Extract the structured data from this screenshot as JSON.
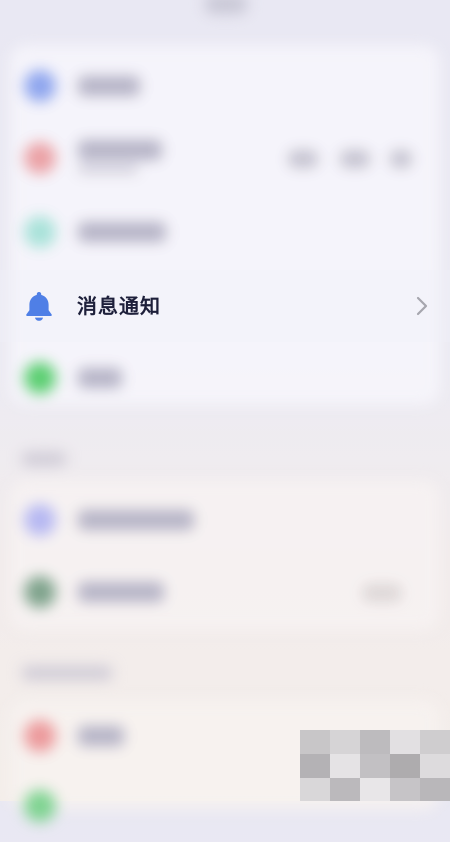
{
  "notification_row": {
    "label": "消息通知",
    "icon": "bell-icon",
    "trailing_icon": "chevron-right-icon",
    "icon_color": "#4f7fe6"
  },
  "colors": {
    "label_text": "#1d1f3a",
    "chevron": "#a6a6ae"
  }
}
